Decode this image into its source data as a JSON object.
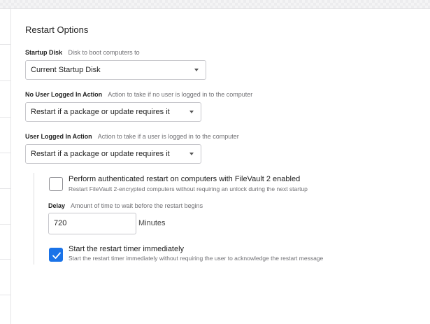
{
  "section": {
    "title": "Restart Options"
  },
  "startup_disk": {
    "label": "Startup Disk",
    "description": "Disk to boot computers to",
    "value": "Current Startup Disk"
  },
  "no_user_action": {
    "label": "No User Logged In Action",
    "description": "Action to take if no user is logged in to the computer",
    "value": "Restart if a package or update requires it"
  },
  "user_action": {
    "label": "User Logged In Action",
    "description": "Action to take if a user is logged in to the computer",
    "value": "Restart if a package or update requires it"
  },
  "filevault": {
    "checked": false,
    "title": "Perform authenticated restart on computers with FileVault 2 enabled",
    "description": "Restart FileVault 2-encrypted computers without requiring an unlock during the next startup"
  },
  "delay": {
    "label": "Delay",
    "description": "Amount of time to wait before the restart begins",
    "value": "720",
    "unit": "Minutes"
  },
  "timer": {
    "checked": true,
    "title": "Start the restart timer immediately",
    "description": "Start the restart timer immediately without requiring the user to acknowledge the restart message"
  },
  "colors": {
    "accent": "#1a73e8"
  },
  "icons": {
    "dropdown": "chevron-down-icon",
    "check": "checkmark-icon"
  }
}
